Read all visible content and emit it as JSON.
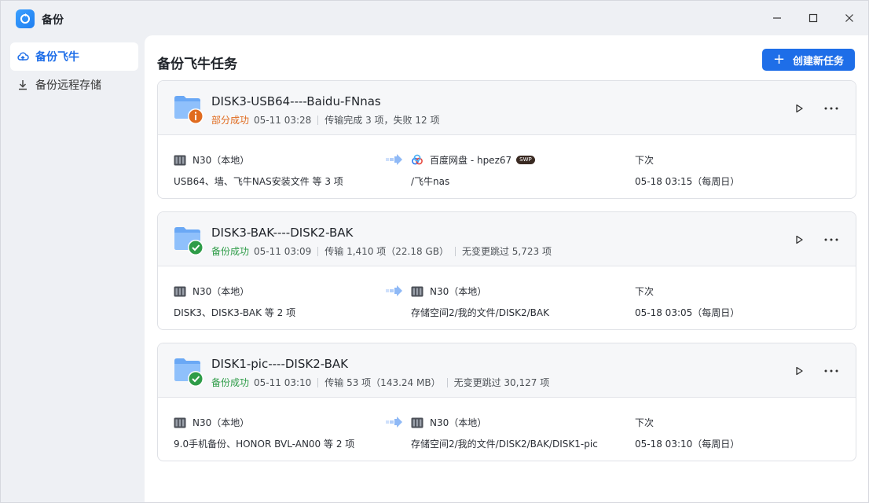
{
  "window": {
    "title": "备份"
  },
  "sidebar": {
    "items": [
      {
        "label": "备份飞牛",
        "icon": "cloud-upload-icon",
        "active": true
      },
      {
        "label": "备份远程存储",
        "icon": "download-icon",
        "active": false
      }
    ]
  },
  "main": {
    "title": "备份飞牛任务",
    "create_label": "创建新任务",
    "tasks": [
      {
        "name": "DISK3-USB64----Baidu-FNnas",
        "status": "部分成功",
        "status_type": "warning",
        "time": "05-11 03:28",
        "detail1": "传输完成 3 项，失败 12 项",
        "detail2": "",
        "source_device": "N30（本地）",
        "source_items": "USB64、墙、飞牛NAS安装文件 等 3 项",
        "dest_device": "百度网盘 - hpez67",
        "dest_badge": "SWP",
        "dest_path": "/飞牛nas",
        "next_label": "下次",
        "next_time": "05-18 03:15（每周日）"
      },
      {
        "name": "DISK3-BAK----DISK2-BAK",
        "status": "备份成功",
        "status_type": "success",
        "time": "05-11 03:09",
        "detail1": "传输 1,410 项（22.18 GB）",
        "detail2": "无变更跳过 5,723 项",
        "source_device": "N30（本地）",
        "source_items": "DISK3、DISK3-BAK 等 2 项",
        "dest_device": "N30（本地）",
        "dest_badge": "",
        "dest_path": "存储空间2/我的文件/DISK2/BAK",
        "next_label": "下次",
        "next_time": "05-18 03:05（每周日）"
      },
      {
        "name": "DISK1-pic----DISK2-BAK",
        "status": "备份成功",
        "status_type": "success",
        "time": "05-11 03:10",
        "detail1": "传输 53 项（143.24 MB）",
        "detail2": "无变更跳过 30,127 项",
        "source_device": "N30（本地）",
        "source_items": "9.0手机备份、HONOR BVL-AN00 等 2 项",
        "dest_device": "N30（本地）",
        "dest_badge": "",
        "dest_path": "存储空间2/我的文件/DISK2/BAK/DISK1-pic",
        "next_label": "下次",
        "next_time": "05-18 03:10（每周日）"
      }
    ]
  },
  "colors": {
    "accent": "#1e6ee8",
    "warning": "#e06b1f",
    "success": "#2e9c48"
  }
}
